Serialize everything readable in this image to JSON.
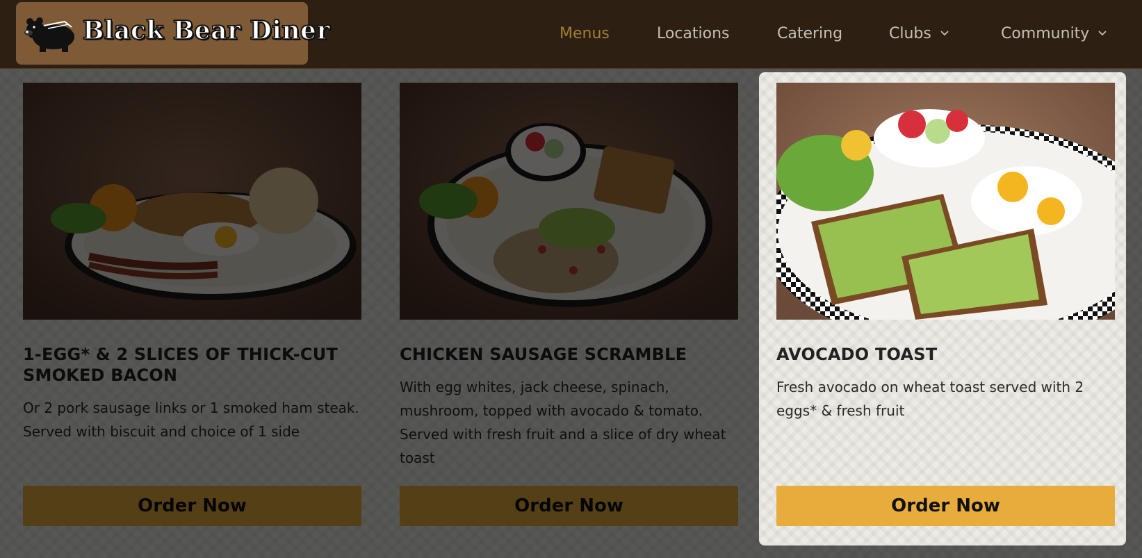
{
  "brand": {
    "name": "Black Bear Diner",
    "logo_icon": "bear-logo-icon"
  },
  "nav": {
    "items": [
      {
        "label": "Menus",
        "active": true,
        "dropdown": false
      },
      {
        "label": "Locations",
        "active": false,
        "dropdown": false
      },
      {
        "label": "Catering",
        "active": false,
        "dropdown": false
      },
      {
        "label": "Clubs",
        "active": false,
        "dropdown": true
      },
      {
        "label": "Community",
        "active": false,
        "dropdown": true
      }
    ],
    "active_color": "#a17d36",
    "inactive_color": "#c4c0b8"
  },
  "menu_items": [
    {
      "title": "1-EGG* & 2 SLICES OF THICK-CUT SMOKED BACON",
      "description": "Or 2 pork sausage links or 1 smoked ham steak. Served with biscuit and choice of 1 side",
      "button_label": "Order Now",
      "highlighted": false
    },
    {
      "title": "CHICKEN SAUSAGE SCRAMBLE",
      "description": "With egg whites, jack cheese, spinach, mushroom, topped with avocado & tomato. Served with fresh fruit and a slice of dry wheat toast",
      "button_label": "Order Now",
      "highlighted": false
    },
    {
      "title": "AVOCADO TOAST",
      "description": "Fresh avocado on wheat toast served with 2 eggs* & fresh fruit",
      "button_label": "Order Now",
      "highlighted": true
    }
  ],
  "colors": {
    "header_bg": "#2d2013",
    "logo_bg": "#7e5a36",
    "button": "#e7ac3c",
    "page_bg": "#ecebe6"
  }
}
